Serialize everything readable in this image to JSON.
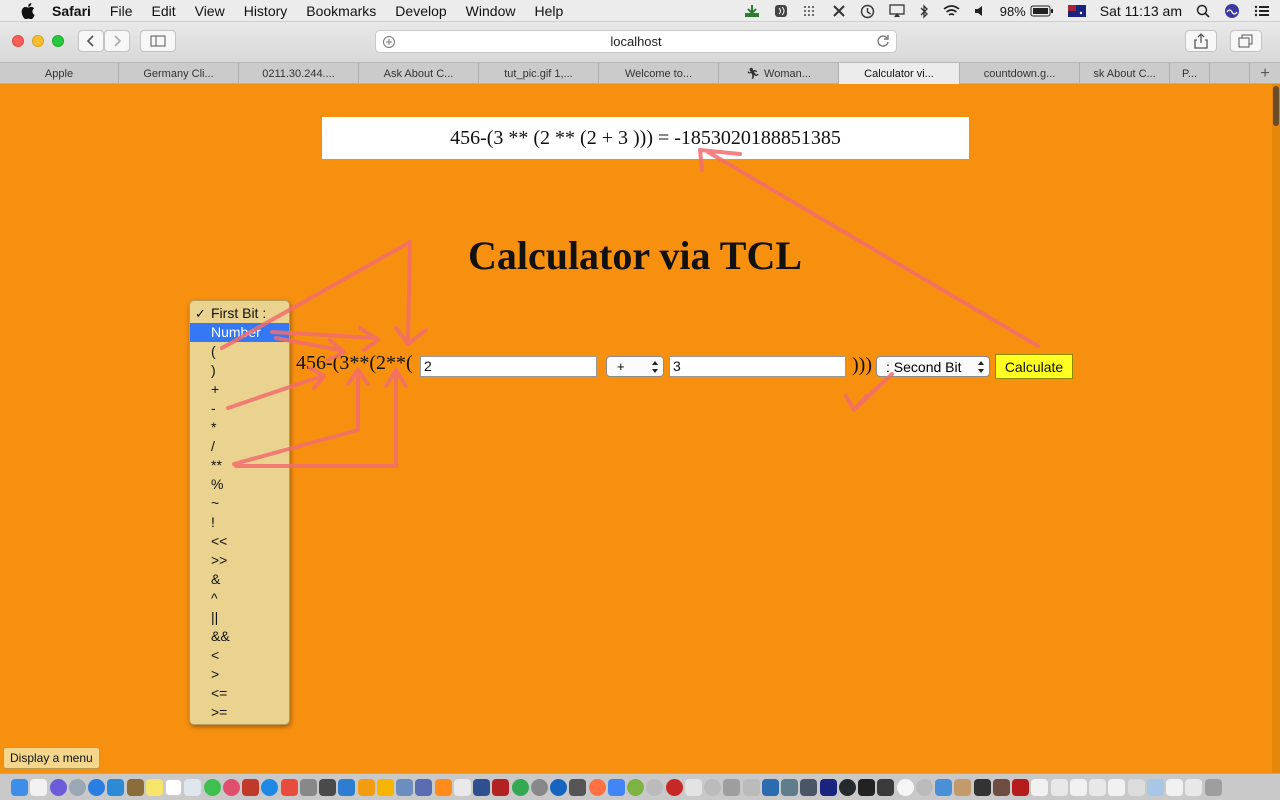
{
  "menubar": {
    "app_name": "Safari",
    "items": [
      "File",
      "Edit",
      "View",
      "History",
      "Bookmarks",
      "Develop",
      "Window",
      "Help"
    ],
    "battery": "98%",
    "clock": "Sat 11:13 am"
  },
  "toolbar": {
    "address": "localhost"
  },
  "tabs": [
    {
      "label": "Apple",
      "active": false
    },
    {
      "label": "Germany Cli...",
      "active": false
    },
    {
      "label": "0211.30.244....",
      "active": false
    },
    {
      "label": "Ask About C...",
      "active": false
    },
    {
      "label": "tut_pic.gif 1,...",
      "active": false
    },
    {
      "label": "Welcome to...",
      "active": false
    },
    {
      "label": "Woman...",
      "active": false
    },
    {
      "label": "Calculator vi...",
      "active": true
    },
    {
      "label": "countdown.g...",
      "active": false
    },
    {
      "label": "sk About C...",
      "active": false
    },
    {
      "label": "P...",
      "active": false
    }
  ],
  "page": {
    "result": "456-(3 ** (2 ** (2 + 3 ))) = -1853020188851385",
    "title": "Calculator via TCL",
    "expression_prefix": "456-(3**(2**(",
    "first_number": "2",
    "operator": "+",
    "second_number": "3",
    "expression_suffix": ")))",
    "second_bit_label": ": Second Bit",
    "calculate_label": "Calculate"
  },
  "dropdown": {
    "options": [
      "First Bit :",
      "Number",
      "(",
      ")",
      "+",
      "-",
      "*",
      "/",
      "**",
      "%",
      "~",
      "!",
      "<<",
      ">>",
      "&",
      "^",
      "||",
      "&&",
      "<",
      ">",
      "<=",
      ">="
    ],
    "checked_index": 0,
    "highlighted_index": 1
  },
  "status_hint": "Display a menu",
  "colors": {
    "page_background": "#f7900f",
    "dropdown_background": "#ead38f",
    "highlight": "#3478f6",
    "calculate_button": "#ffff22",
    "annotation_arrows": "#f26d6d"
  }
}
